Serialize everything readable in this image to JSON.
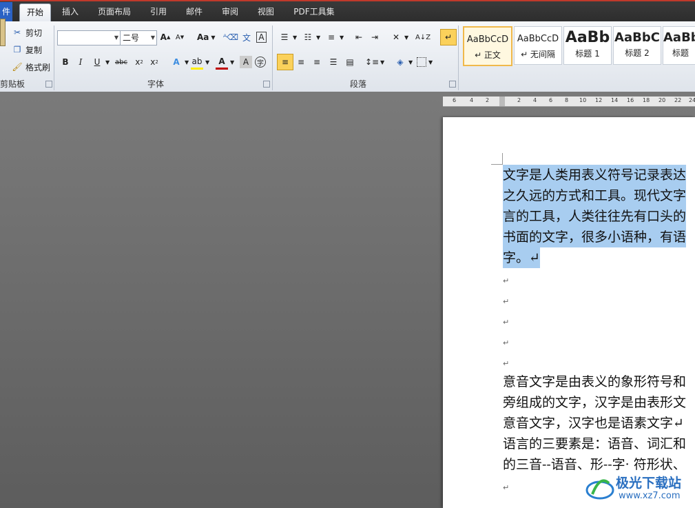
{
  "tabs": [
    {
      "label": "件"
    },
    {
      "label": "开始"
    },
    {
      "label": "插入"
    },
    {
      "label": "页面布局"
    },
    {
      "label": "引用"
    },
    {
      "label": "邮件"
    },
    {
      "label": "审阅"
    },
    {
      "label": "视图"
    },
    {
      "label": "PDF工具集"
    }
  ],
  "clipboard": {
    "cut": "剪切",
    "copy": "复制",
    "format_painter": "格式刷",
    "group": "剪贴板"
  },
  "font": {
    "name_value": "",
    "size_value": "二号",
    "group": "字体",
    "change_case": "Aa",
    "grow": "A",
    "shrink": "A"
  },
  "paragraph": {
    "group": "段落"
  },
  "styles": [
    {
      "sample": "AaBbCcD",
      "name": "↵ 正文"
    },
    {
      "sample": "AaBbCcD",
      "name": "↵ 无间隔"
    },
    {
      "sample": "AaBb",
      "name": "标题 1"
    },
    {
      "sample": "AaBbC",
      "name": "标题 2"
    },
    {
      "sample": "AaBb",
      "name": "标题"
    }
  ],
  "ruler": [
    "6",
    "4",
    "2",
    "",
    "2",
    "4",
    "6",
    "8",
    "10",
    "12",
    "14",
    "16",
    "18",
    "20",
    "22",
    "24"
  ],
  "document": {
    "selected_lines": [
      "文字是人类用表义符号记录表达",
      "之久远的方式和工具。现代文字",
      "言的工具，人类往往先有口头的",
      "书面的文字，很多小语种，有语",
      "字。↵"
    ],
    "empty_marks": [
      "↵",
      "↵",
      "↵",
      "↵",
      "↵"
    ],
    "body_lines": [
      "意音文字是由表义的象形符号和",
      "旁组成的文字，汉字是由表形文",
      "意音文字，汉字也是语素文字↵",
      "语言的三要素是：语音、词汇和",
      "的三音--语音、形--字· 符形状、"
    ],
    "last_mark": "↵"
  },
  "watermark": {
    "title": "极光下载站",
    "url": "www.xz7.com"
  },
  "colors": {
    "accent": "#f0b84a",
    "selection": "#a8cdf0",
    "file_tab": "#2b62c4"
  }
}
